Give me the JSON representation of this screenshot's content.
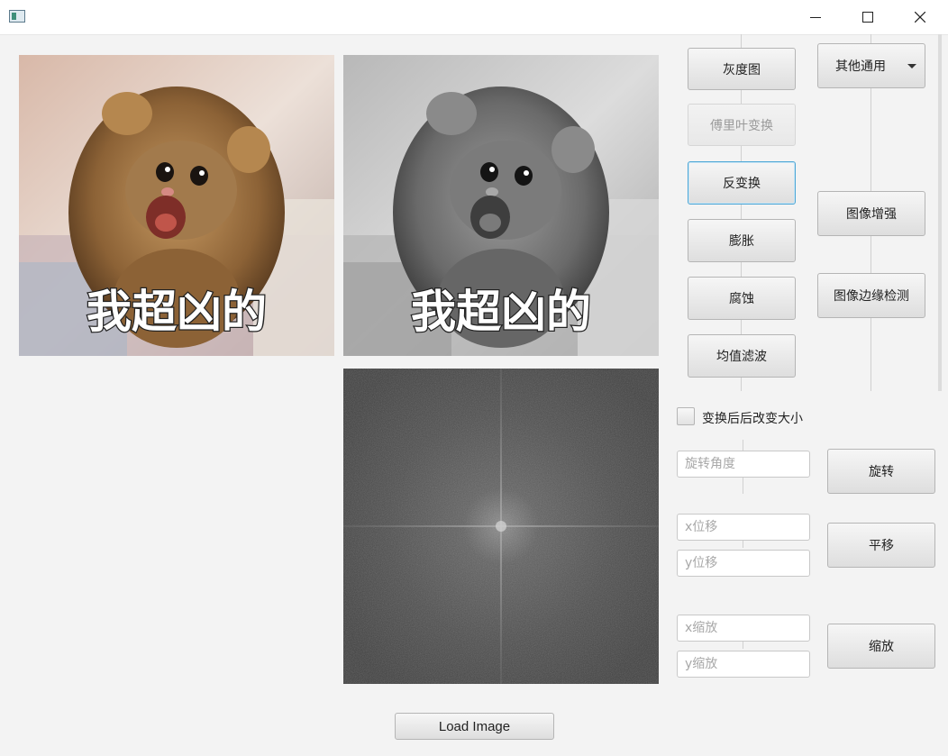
{
  "window": {
    "icon": "app-window-icon",
    "controls": [
      "minimize-icon",
      "maximize-icon",
      "close-icon"
    ]
  },
  "images": {
    "original_caption": "我超凶的",
    "grayscale_caption": "我超凶的",
    "colors": {
      "fur": "#a27a4c",
      "fur_dark": "#6b4a2a",
      "bg": "#d9c9c0",
      "mouth": "#c0554a"
    }
  },
  "buttons": {
    "grayscale": "灰度图",
    "fourier": "傅里叶变换",
    "inverse": "反变换",
    "dilate": "膨胀",
    "erode": "腐蚀",
    "mean_filter": "均值滤波",
    "other": "其他通用",
    "enhance": "图像增强",
    "edge": "图像边缘检测",
    "rotate": "旋转",
    "translate": "平移",
    "scale": "缩放",
    "load": "Load Image"
  },
  "checkbox": {
    "label": "变换后后改变大小",
    "checked": false
  },
  "inputs": {
    "rotate_angle": {
      "placeholder": "旋转角度",
      "value": ""
    },
    "x_shift": {
      "placeholder": "x位移",
      "value": ""
    },
    "y_shift": {
      "placeholder": "y位移",
      "value": ""
    },
    "x_scale": {
      "placeholder": "x缩放",
      "value": ""
    },
    "y_scale": {
      "placeholder": "y缩放",
      "value": ""
    }
  }
}
